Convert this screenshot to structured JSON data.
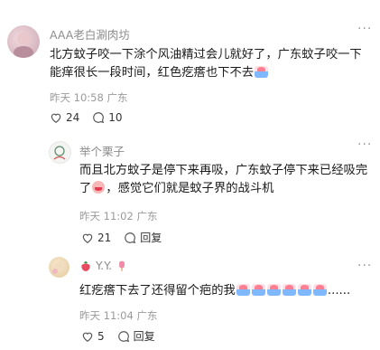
{
  "comments": [
    {
      "username": "AAA老白涮肉坊",
      "text": "北方蚊子咬一下涂个风油精过会儿就好了，广东蚊子咬一下能痒很长一段时间，红色疙瘩也下不去",
      "time": "昨天 10:58 广东",
      "likes": "24",
      "replies": "10",
      "emoji": "emoji-sticker"
    },
    {
      "username": "举个栗子",
      "text_a": "而且北方蚊子是停下来再吸，广东蚊子停下来已经吸完了",
      "text_b": "，感觉它们就是蚊子界的战斗机",
      "time": "昨天 11:02 广东",
      "likes": "21",
      "reply_label": "回复",
      "emoji": "angry-face"
    },
    {
      "username": "Y.Y.",
      "text": "红疙瘩下去了还得留个疤的我",
      "text_end": "......",
      "time": "昨天 11:04 广东",
      "likes": "5",
      "reply_label": "回复",
      "emoji_count": 6
    }
  ],
  "more_label": "···",
  "colors": {
    "meta": "#9a9a9a",
    "name": "#8c8c8c",
    "text": "#1a1a1a"
  }
}
